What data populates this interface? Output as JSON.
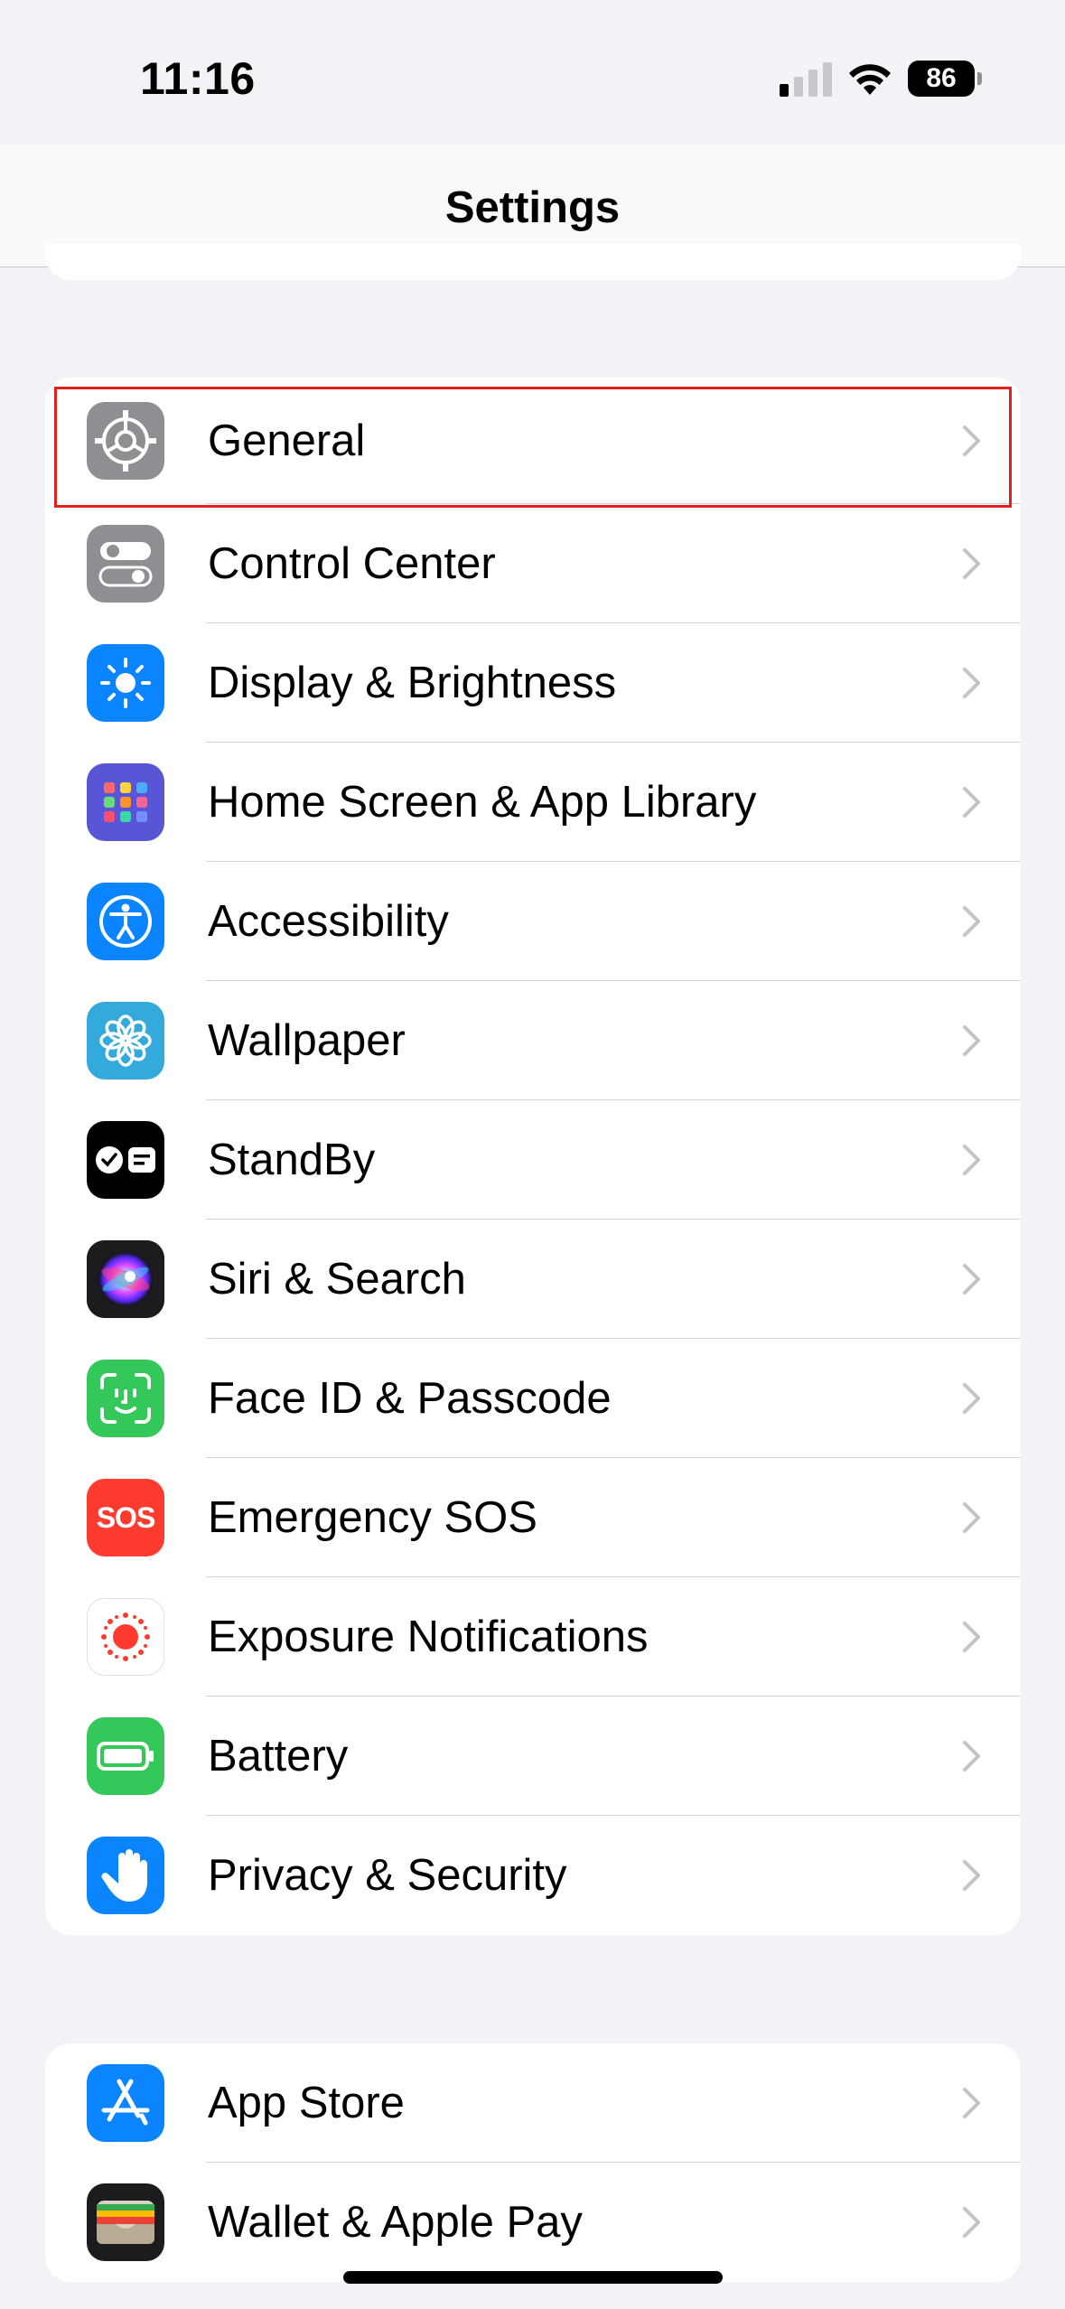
{
  "status": {
    "time": "11:16",
    "battery": "86"
  },
  "nav": {
    "title": "Settings"
  },
  "group1": [
    {
      "label": "General",
      "icon": "gear-icon",
      "color": "#8e8e93"
    },
    {
      "label": "Control Center",
      "icon": "toggles-icon",
      "color": "#8e8e93"
    },
    {
      "label": "Display & Brightness",
      "icon": "sun-icon",
      "color": "#0a84ff"
    },
    {
      "label": "Home Screen & App Library",
      "icon": "app-grid-icon",
      "color": "#5856d6"
    },
    {
      "label": "Accessibility",
      "icon": "accessibility-icon",
      "color": "#0a84ff"
    },
    {
      "label": "Wallpaper",
      "icon": "flower-icon",
      "color": "#34aadc"
    },
    {
      "label": "StandBy",
      "icon": "standby-icon",
      "color": "#000000"
    },
    {
      "label": "Siri & Search",
      "icon": "siri-icon",
      "color": "#1c1c1e"
    },
    {
      "label": "Face ID & Passcode",
      "icon": "face-id-icon",
      "color": "#34c759"
    },
    {
      "label": "Emergency SOS",
      "icon": "sos-icon",
      "color": "#ff3b30"
    },
    {
      "label": "Exposure Notifications",
      "icon": "exposure-icon",
      "color": "#ffffff"
    },
    {
      "label": "Battery",
      "icon": "battery-icon",
      "color": "#34c759"
    },
    {
      "label": "Privacy & Security",
      "icon": "hand-icon",
      "color": "#0a84ff"
    }
  ],
  "group2": [
    {
      "label": "App Store",
      "icon": "app-store-icon",
      "color": "#0a84ff"
    },
    {
      "label": "Wallet & Apple Pay",
      "icon": "wallet-icon",
      "color": "#1c1c1e"
    }
  ],
  "icons": {
    "sos": "SOS"
  },
  "highlight": {
    "target": "General",
    "color": "#e3201b"
  }
}
